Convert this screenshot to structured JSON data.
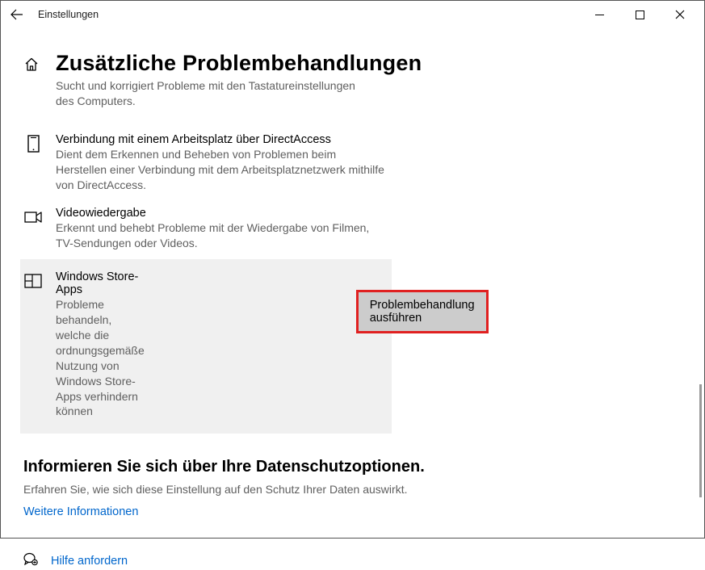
{
  "titlebar": {
    "title": "Einstellungen"
  },
  "page": {
    "title": "Zusätzliche Problembehandlungen",
    "subtitle": "Sucht und korrigiert Probleme mit den Tastatureinstellungen des Computers."
  },
  "items": [
    {
      "title": "Verbindung mit einem Arbeitsplatz über DirectAccess",
      "desc": "Dient dem Erkennen und Beheben von Problemen beim Herstellen einer Verbindung mit dem Arbeitsplatznetzwerk mithilfe von DirectAccess."
    },
    {
      "title": "Videowiedergabe",
      "desc": "Erkennt und behebt Probleme mit der Wiedergabe von Filmen, TV-Sendungen oder Videos."
    },
    {
      "title": "Windows Store-Apps",
      "desc": "Probleme behandeln, welche die ordnungsgemäße Nutzung von Windows Store-Apps verhindern können"
    }
  ],
  "run_button": "Problembehandlung ausführen",
  "privacy": {
    "title": "Informieren Sie sich über Ihre Datenschutzoptionen.",
    "desc": "Erfahren Sie, wie sich diese Einstellung auf den Schutz Ihrer Daten auswirkt.",
    "link": "Weitere Informationen"
  },
  "help_link": "Hilfe anfordern"
}
